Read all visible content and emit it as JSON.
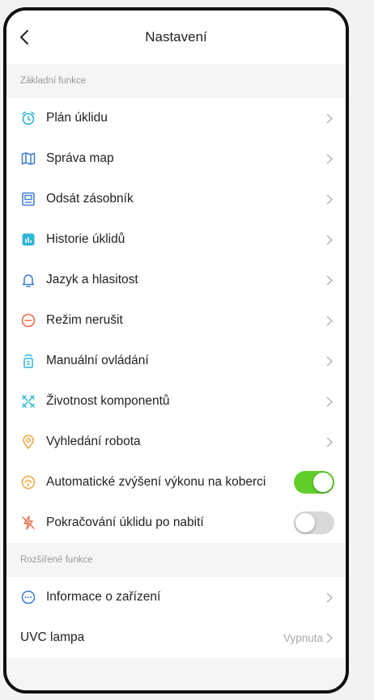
{
  "header": {
    "title": "Nastavení"
  },
  "colors": {
    "accent_orange": "#f2a53a",
    "accent_blue": "#3d7bd6",
    "accent_cyan": "#2cb5d8",
    "accent_red": "#ee6a48",
    "toggle_on": "#5fce2a",
    "toggle_off": "#d9d9d9"
  },
  "sections": {
    "basic": {
      "heading": "Základní funkce",
      "items": [
        {
          "label": "Plán úklidu",
          "icon": "alarm-clock-icon"
        },
        {
          "label": "Správa map",
          "icon": "map-icon"
        },
        {
          "label": "Odsát zásobník",
          "icon": "dust-bin-icon"
        },
        {
          "label": "Historie úklidů",
          "icon": "history-chart-icon"
        },
        {
          "label": "Jazyk a hlasitost",
          "icon": "bell-icon"
        },
        {
          "label": "Režim nerušit",
          "icon": "do-not-disturb-icon"
        },
        {
          "label": "Manuální ovládání",
          "icon": "remote-control-icon"
        },
        {
          "label": "Životnost komponentů",
          "icon": "components-icon"
        },
        {
          "label": "Vyhledání robota",
          "icon": "location-pin-icon"
        },
        {
          "label": "Automatické zvýšení výkonu na koberci",
          "icon": "carpet-boost-icon",
          "toggle": true
        },
        {
          "label": "Pokračování úklidu po nabití",
          "icon": "charging-bolt-icon",
          "toggle": false
        }
      ]
    },
    "advanced": {
      "heading": "Rozšířené funkce",
      "items": [
        {
          "label": "Informace o  zařízení",
          "icon": "info-dots-icon"
        },
        {
          "label": "UVC lampa",
          "value": "Vypnuta"
        }
      ]
    }
  }
}
